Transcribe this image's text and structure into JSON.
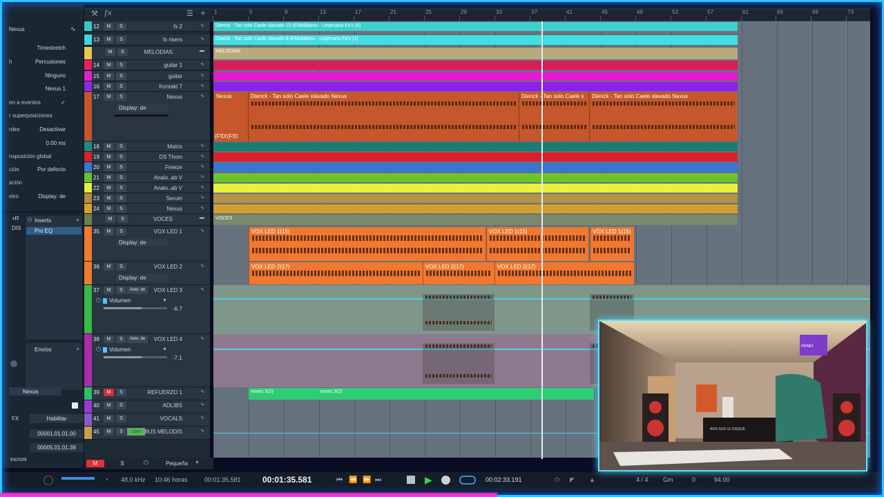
{
  "inspector": {
    "instrument": "Nexus",
    "rows": [
      {
        "label": "",
        "value": "Timestretch"
      },
      {
        "label": "h",
        "value": "Percusiones"
      },
      {
        "label": "",
        "value": "Ninguno"
      },
      {
        "label": "",
        "value": "Nexus 1"
      },
      {
        "label": "en a eventos",
        "value": "✓"
      },
      {
        "label": "r superposiciones",
        "value": ""
      },
      {
        "label": "rdes",
        "value": "Desactivar"
      },
      {
        "label": "",
        "value": "0.00 ms"
      },
      {
        "label": "nsposición global",
        "value": ""
      },
      {
        "label": "ción",
        "value": "Por defecto"
      },
      {
        "label": "ación",
        "value": ""
      },
      {
        "label": "etro",
        "value": "Display: de"
      }
    ],
    "inserts_label": "Inserts",
    "plugin": "Pro EQ",
    "envios_label": "Envíos",
    "channel_name": "Nexus",
    "fx_label": "FX",
    "habilitar": "Habilitar",
    "pos1": "00001.01.01.00",
    "pos2": "00005.01.01.39",
    "sync_label": "incroni",
    "plusr": "+R",
    "dis": "DIS"
  },
  "tracks": [
    {
      "num": "12",
      "name": "fx 2",
      "color": "#37c7c8",
      "clip": "Dierick - Tan solo Caele slavado 15-IEMidilatino - Leqenario Fx's (8)",
      "clipcolor": "#3ed0cf"
    },
    {
      "num": "13",
      "name": "fx risers",
      "color": "#3fd6dc",
      "clip": "Dierick - Tan solo Caele slavado 8-IEMidilatino - Leqenario Fx's (1)",
      "clipcolor": "#40dfe4"
    },
    {
      "num": "",
      "name": "MELODIAS",
      "color": "#e8c84a",
      "clip": "MELODIAS",
      "clipcolor": "#b7aa7f"
    },
    {
      "num": "14",
      "name": "guitar 1",
      "color": "#e91e63",
      "clipcolor": "#d81b5a"
    },
    {
      "num": "15",
      "name": "guitar",
      "color": "#e020c8",
      "clipcolor": "#e21bd1"
    },
    {
      "num": "16",
      "name": "Kontakt 7",
      "color": "#8a2be2",
      "clipcolor": "#8c22ea"
    },
    {
      "num": "17",
      "name": "Nexus",
      "display": "Display: de",
      "color": "#c8552a",
      "clips": [
        "Nexus",
        "Dierick - Tan solo Caele slavado Nexus",
        "Dierick - Tan solo Caele s",
        "Dierick - Tan solo Caele slavado Nexus"
      ],
      "clipcolor": "#c4572c",
      "note": "(F!D!(F!D"
    },
    {
      "num": "18",
      "name": "Matrix",
      "color": "#1e8a80",
      "clipcolor": "#197d72"
    },
    {
      "num": "19",
      "name": "DS Thom",
      "color": "#e02020",
      "clipcolor": "#dc1e28"
    },
    {
      "num": "20",
      "name": "Freeze",
      "color": "#3b78d0",
      "clipcolor": "#3a76cf"
    },
    {
      "num": "21",
      "name": "Analo..ab V",
      "color": "#69c22a",
      "clipcolor": "#6ac52a"
    },
    {
      "num": "22",
      "name": "Analo..ab V",
      "color": "#e6ef3a",
      "clipcolor": "#e9f23a"
    },
    {
      "num": "23",
      "name": "Serum",
      "color": "#b98b3e",
      "clipcolor": "#b8924a"
    },
    {
      "num": "24",
      "name": "Nexus",
      "color": "#d4a32c",
      "clipcolor": "#cfa030"
    },
    {
      "num": "",
      "name": "VOCES",
      "color": "#6a7f50",
      "clip": "VOCES",
      "clipcolor": "#7a8a6a"
    },
    {
      "num": "35",
      "name": "VOX LED 1",
      "display": "Display: de",
      "color": "#ef7a2c",
      "clips": [
        "VOX LED 1(15)",
        "VOX LED 1(15)",
        "VOX LED 1(15)"
      ],
      "clipcolor": "#f07830"
    },
    {
      "num": "36",
      "name": "VOX LED 2",
      "display": "Display: de",
      "color": "#ef7a2c",
      "clips": [
        "VOX LED 2(17)",
        "VOX LED 2(17)",
        "VOX LED 2(17)"
      ],
      "clipcolor": "#f07830"
    },
    {
      "num": "37",
      "name": "VOX LED 3",
      "auto": "Auto: de",
      "param": "Volumen",
      "db": "-6.7",
      "color": "#3bb84a"
    },
    {
      "num": "38",
      "name": "VOX LED 4",
      "auto": "Auto: de",
      "param": "Volumen",
      "db": "-7.1",
      "color": "#b02aa8"
    },
    {
      "num": "39",
      "name": "REFUERZO 1",
      "color": "#2bbf6a",
      "clips": [
        "voxes 3(2)",
        "voxes 3(2)"
      ],
      "clipcolor": "#2ecc75"
    },
    {
      "num": "40",
      "name": "ADLIBS",
      "color": "#9b3bd0"
    },
    {
      "num": "41",
      "name": "VOCALS",
      "color": "#8a5acd"
    },
    {
      "num": "45",
      "name": "BUS MELODIS",
      "color": "#c8a04a",
      "leer": "Leer"
    }
  ],
  "ruler": [
    "1",
    "5",
    "9",
    "13",
    "17",
    "21",
    "25",
    "29",
    "33",
    "37",
    "41",
    "45",
    "49",
    "53",
    "57",
    "61",
    "65",
    "69",
    "73"
  ],
  "bottom": {
    "m": "M",
    "s": "S",
    "size": "Pequeña"
  },
  "transport": {
    "rate": "48.0 kHz",
    "hours": "10:46 horas",
    "time_small": "00:01:35.581",
    "time_big": "00:01:35.581",
    "end": "00:02:33.191",
    "sig": "4 / 4",
    "key": "Gm",
    "zero": "0",
    "tempo": "94.00"
  },
  "topbar": {
    "fx": "ƒx"
  },
  "webcam": {
    "brand": "PANKI",
    "record": "AVIS SUR LE DISQUE"
  }
}
